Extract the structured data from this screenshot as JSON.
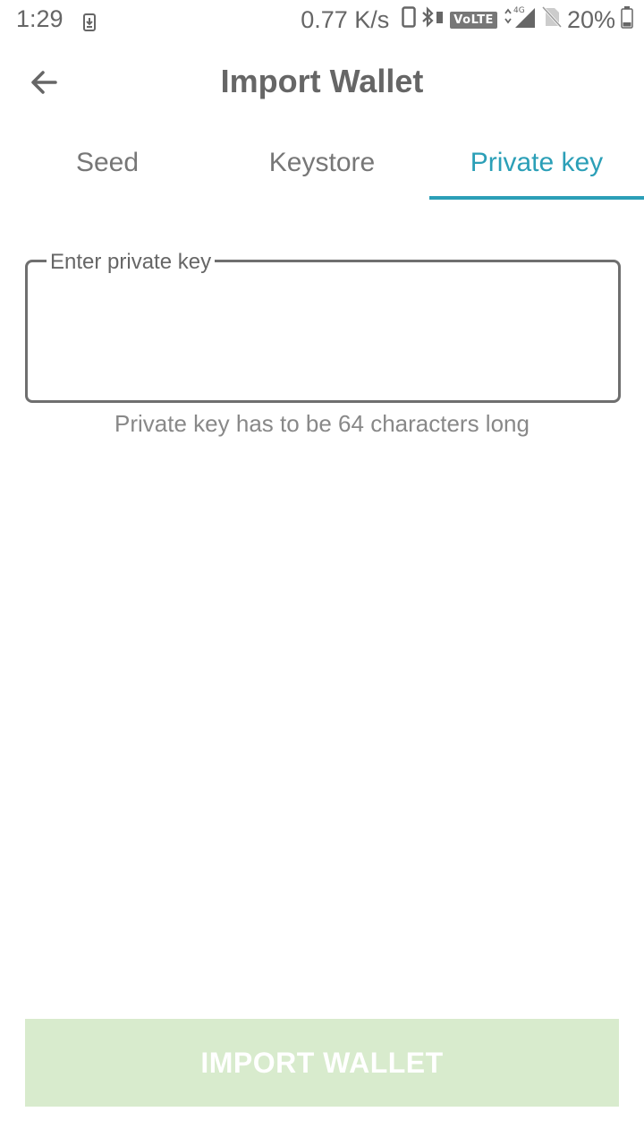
{
  "status_bar": {
    "time": "1:29",
    "net_speed": "0.77 K/s",
    "network_badge": "VoLTE",
    "network_type": "4G",
    "battery": "20%",
    "icons": [
      "download-icon",
      "phone-icon",
      "bluetooth-icon",
      "signal-icon",
      "no-sim-icon",
      "battery-icon"
    ]
  },
  "app_bar": {
    "title": "Import Wallet",
    "back_icon": "arrow-left-icon"
  },
  "tabs": [
    {
      "label": "Seed",
      "selected": false
    },
    {
      "label": "Keystore",
      "selected": false
    },
    {
      "label": "Private key",
      "selected": true
    }
  ],
  "private_key_field": {
    "label": "Enter private key",
    "value": "",
    "hint": "Private key has to be 64 characters long"
  },
  "import_button": {
    "label": "IMPORT WALLET",
    "enabled": false
  },
  "colors": {
    "accent": "#2b9fb7",
    "button_disabled_bg": "#d8ebcd",
    "text": "#666666"
  }
}
